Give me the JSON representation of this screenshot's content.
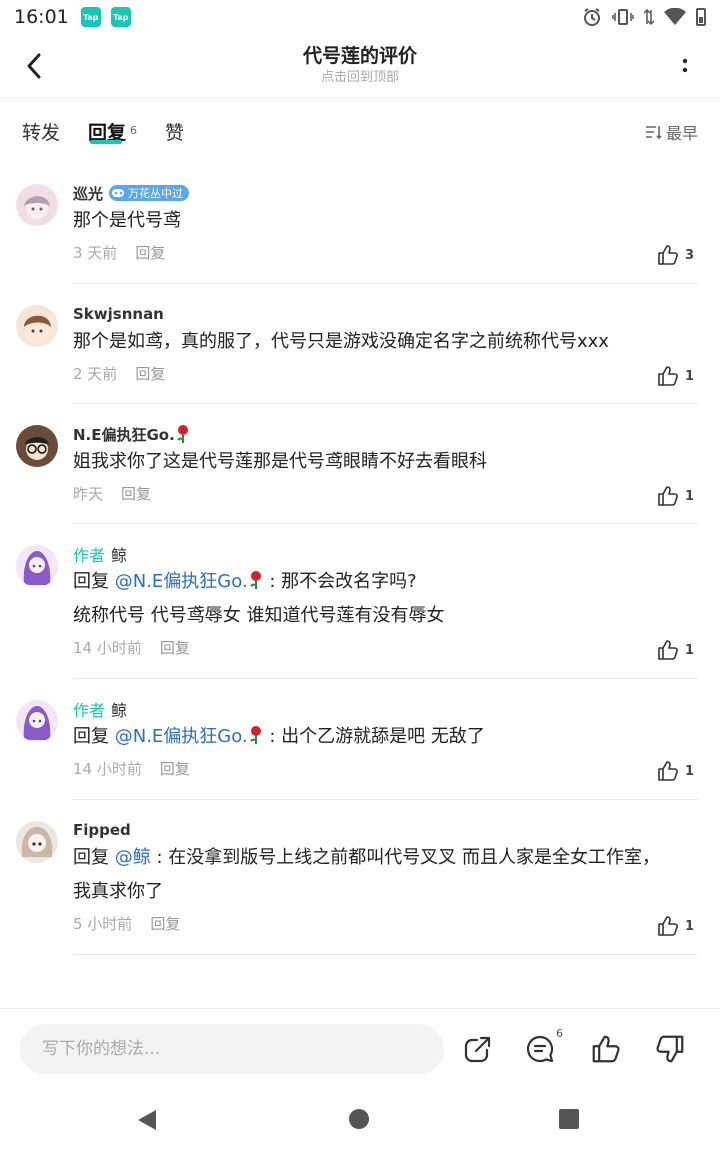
{
  "status_bar": {
    "time": "16:01",
    "app_icon_1": "Tap",
    "app_icon_2": "Tap",
    "icons": [
      "alarm-icon",
      "vibrate-icon",
      "data-icon",
      "wifi-icon",
      "battery-icon"
    ]
  },
  "header": {
    "title": "代号莲的评价",
    "subtitle": "点击回到顶部"
  },
  "tabs": {
    "repost": "转发",
    "reply": "回复",
    "reply_count": "6",
    "like": "赞",
    "sort": "最早"
  },
  "colors": {
    "accent": "#14c8b5",
    "mention": "#2c6fc7",
    "badge": "#5aa7ee"
  },
  "comments": [
    {
      "name": "巡光",
      "badge": "万花丛中过",
      "text": "那个是代号鸢",
      "time": "3 天前",
      "reply": "回复",
      "likes": "3"
    },
    {
      "name": "Skwjsnnan",
      "text": "那个是如鸢，真的服了，代号只是游戏没确定名字之前统称代号xxx",
      "time": "2 天前",
      "reply": "回复",
      "likes": "1"
    },
    {
      "name": "N.E偏执狂Go.",
      "text": "姐我求你了这是代号莲那是代号鸢眼睛不好去看眼科",
      "time": "昨天",
      "reply": "回复",
      "likes": "1"
    },
    {
      "author_tag": "作者",
      "name": "鲸",
      "reply_prefix": "回复",
      "mention": "@N.E偏执狂Go.",
      "text1": " : 那不会改名字吗?",
      "text2": "统称代号 代号鸢辱女 谁知道代号莲有没有辱女",
      "time": "14 小时前",
      "reply": "回复",
      "likes": "1"
    },
    {
      "author_tag": "作者",
      "name": "鲸",
      "reply_prefix": "回复",
      "mention": "@N.E偏执狂Go.",
      "text1": " : 出个乙游就舔是吧 无敌了",
      "time": "14 小时前",
      "reply": "回复",
      "likes": "1"
    },
    {
      "name": "Fipped",
      "reply_prefix": "回复",
      "mention": "@鲸",
      "text1": " : 在没拿到版号上线之前都叫代号叉叉 而且人家是全女工作室，",
      "text2": "我真求你了",
      "time": "5 小时前",
      "reply": "回复",
      "likes": "1"
    }
  ],
  "input_bar": {
    "placeholder": "写下你的想法...",
    "comment_count": "6"
  }
}
